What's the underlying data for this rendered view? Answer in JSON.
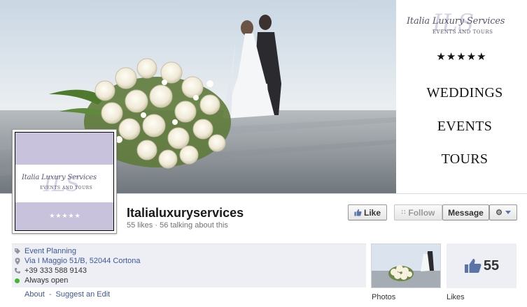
{
  "cover": {
    "brand_script": "Italia Luxury Services",
    "brand_sub": "EVENTS AND TOURS",
    "stars": "★★★★★",
    "items": [
      "WEDDINGS",
      "EVENTS",
      "TOURS"
    ]
  },
  "profile_picture": {
    "brand_script": "Italia Luxury Services",
    "brand_sub": "EVENTS AND TOURS",
    "stars": "★★★★★"
  },
  "page": {
    "name": "Italialuxuryservices",
    "stats": "55 likes · 56 talking about this"
  },
  "actions": {
    "like": "Like",
    "follow": "Follow",
    "message": "Message",
    "settings_icon": "gear-icon"
  },
  "info": {
    "category": "Event Planning",
    "address": "Via I Maggio 51/B, 52044 Cortona",
    "phone": "+39 333 588 9143",
    "hours": "Always open"
  },
  "about_links": {
    "about": "About",
    "separator": "-",
    "suggest_edit": "Suggest an Edit"
  },
  "apps": {
    "photos_label": "Photos",
    "likes_label": "Likes",
    "likes_count": "55"
  },
  "colors": {
    "link": "#3b5998",
    "profile_lavender": "#c9c2dd",
    "info_bg": "#edeff4",
    "open_status": "#42b72a"
  }
}
